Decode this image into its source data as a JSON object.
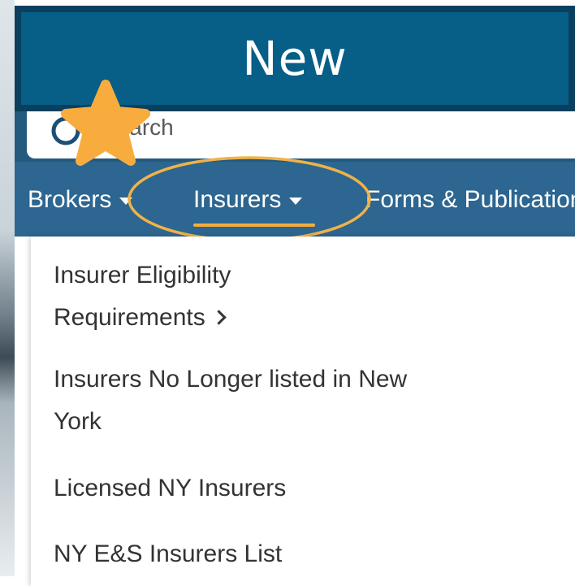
{
  "banner": {
    "title": "New"
  },
  "search": {
    "placeholder": "Search"
  },
  "nav": {
    "brokers_label": "Brokers",
    "insurers_label": "Insurers",
    "forms_label": "Forms & Publications"
  },
  "dropdown": {
    "items": [
      {
        "label_line1": "Insurer Eligibility",
        "label_line2": "Requirements"
      },
      {
        "label_line1": "Insurers No Longer listed in New",
        "label_line2": "York"
      },
      {
        "label_line1": "Licensed NY Insurers"
      },
      {
        "label_line1": "NY E&S Insurers List"
      }
    ]
  },
  "colors": {
    "banner": "#075e86",
    "nav": "#2d6690",
    "accent": "#f5ae3c",
    "star": "#f8ac3d"
  },
  "icons": {
    "star": "star-icon",
    "search": "search-icon",
    "chevron": "chevron-right-icon",
    "caret": "caret-down-icon"
  }
}
